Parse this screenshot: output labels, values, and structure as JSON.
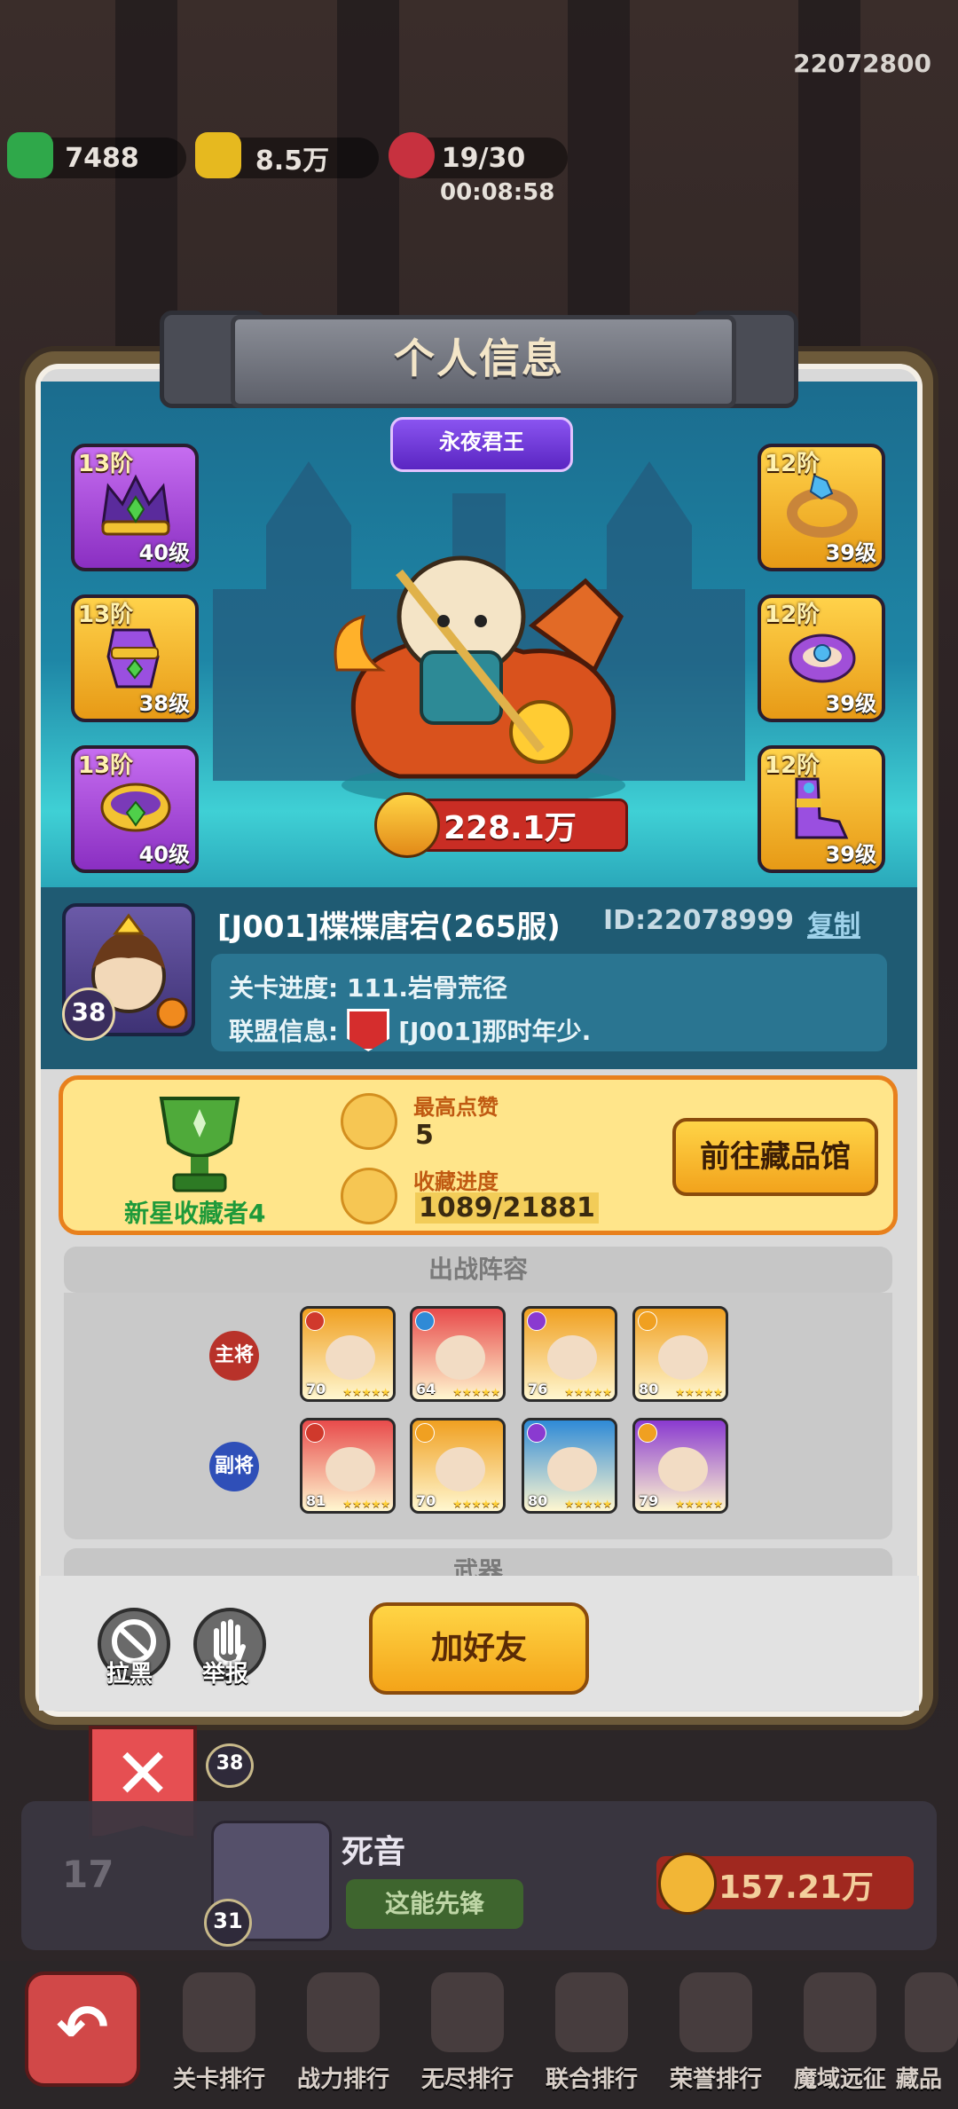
{
  "top": {
    "uid": "22072800",
    "resources": [
      {
        "name": "gems",
        "value": "7488"
      },
      {
        "name": "gold",
        "value": "8.5万"
      },
      {
        "name": "stamina",
        "value": "19/30"
      }
    ],
    "timer": "00:08:58"
  },
  "modal": {
    "title": "个人信息",
    "title_badge": "永夜君王",
    "equipment": [
      {
        "icon": "crown-icon",
        "tier": "13阶",
        "level": "40级",
        "rarity": "purple"
      },
      {
        "icon": "gauntlet-icon",
        "tier": "13阶",
        "level": "38级",
        "rarity": "gold"
      },
      {
        "icon": "belt-icon",
        "tier": "13阶",
        "level": "40级",
        "rarity": "purple"
      },
      {
        "icon": "ring-icon",
        "tier": "12阶",
        "level": "39级",
        "rarity": "gold"
      },
      {
        "icon": "bracelet-icon",
        "tier": "12阶",
        "level": "39级",
        "rarity": "gold"
      },
      {
        "icon": "boots-icon",
        "tier": "12阶",
        "level": "39级",
        "rarity": "gold"
      }
    ],
    "power": "228.1万",
    "player": {
      "avatar_level": "38",
      "name": "[J001]楪楪唐宕(265服)",
      "id": "ID:22078999",
      "copy_label": "复制",
      "stage_progress": "关卡进度: 111.岩骨荒径",
      "alliance_label": "联盟信息:",
      "alliance_name": "[J001]那时年少."
    },
    "collection": {
      "collector_title": "新星收藏者4",
      "likes_label": "最高点赞",
      "likes_value": "5",
      "progress_label": "收藏进度",
      "progress_value": "1089/21881",
      "museum_button": "前往藏品馆"
    },
    "lineup": {
      "header": "出战阵容",
      "main_label": "主将",
      "sub_label": "副将",
      "main_heroes": [
        {
          "level": "70",
          "color": "#f0a021",
          "class_color": "#d0392c"
        },
        {
          "level": "64",
          "color": "#e84b4b",
          "class_color": "#2f8ad6"
        },
        {
          "level": "76",
          "color": "#f0a021",
          "class_color": "#8a3ad0"
        },
        {
          "level": "80",
          "color": "#f0a021",
          "class_color": "#f0a021"
        }
      ],
      "sub_heroes": [
        {
          "level": "81",
          "color": "#e84b4b",
          "class_color": "#d0392c"
        },
        {
          "level": "70",
          "color": "#f0a021",
          "class_color": "#f0a021"
        },
        {
          "level": "80",
          "color": "#2f8ad6",
          "class_color": "#8a3ad0"
        },
        {
          "level": "79",
          "color": "#8a3ad0",
          "class_color": "#f0a021"
        }
      ],
      "stars": "★★★★★"
    },
    "weapon_header": "武器",
    "actions": {
      "block_label": "拉黑",
      "report_label": "举报",
      "add_friend_label": "加好友"
    }
  },
  "ranking_row": {
    "rank": "17",
    "avatar_level": "31",
    "name": "死音",
    "title": "这能先锋",
    "power": "157.21万"
  },
  "behind_row": {
    "avatar_level": "38"
  },
  "nav": {
    "tabs": [
      "关卡排行",
      "战力排行",
      "无尽排行",
      "联合排行",
      "荣誉排行",
      "魔域远征",
      "藏品"
    ]
  },
  "colors": {
    "accent_gold": "#ffd447",
    "panel_teal": "#1f5b73",
    "close_red": "#e64f52"
  }
}
